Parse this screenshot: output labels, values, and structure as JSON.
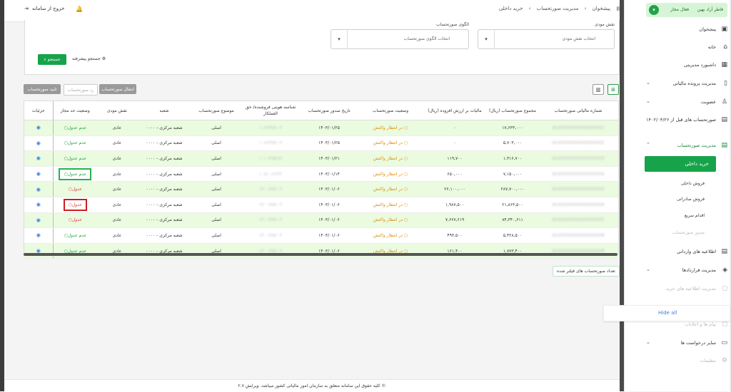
{
  "breadcrumb": [
    "پیشخوان",
    "مدیریت صورتحساب",
    "خرید داخلی"
  ],
  "logout_label": "خروج از سامانه",
  "filters": {
    "role_label": "نقش مودی",
    "role_placeholder": "انتخاب نقش مودی",
    "pattern_label": "الگوی صورتحساب",
    "pattern_placeholder": "انتخاب الگوی صورتحساب",
    "search_button": "جستجو",
    "advanced_search": "جستجو پیشرفته"
  },
  "actions": {
    "transfer": "انتقال صورتحساب",
    "reject": "رد صورتحساب",
    "approve": "تایید صورتحساب"
  },
  "table": {
    "headers": [
      "شماره مالیاتی صورتحساب",
      "مجموع صورتحساب (ریال)",
      "مالیات بر ارزش افزوده (ریال)",
      "وضعیت صورتحساب",
      "تاریخ صدور صورتحساب",
      "شناسه هویتی فروشنده/ حق العملکار",
      "موضوع صورتحساب",
      "شعبه",
      "نقش مودی",
      "وضعیت حد مجاز",
      "جزئیات"
    ],
    "rows": [
      {
        "tax_id": "A1XXXXXXXXXXXXXX01",
        "total": "۱۷,۶۳۳,۰۰۰",
        "vat": "۰",
        "status": "در انتظار واکنش",
        "date": "۱۴۰۳/۰۱/۲۵",
        "seller": "۱۰۸۶۳۳۵۱۰۴",
        "subject": "اصلی",
        "branch": "شعبه مرکزی - ۰۰۰۰",
        "role": "عادی",
        "limit": "عدم عدول",
        "limit_type": "ok"
      },
      {
        "tax_id": "A1XXXXXXXXXXXXXX02",
        "total": "۵,۷۰۳,۰۰۰",
        "vat": "۰",
        "status": "در انتظار واکنش",
        "date": "۱۴۰۳/۰۱/۲۵",
        "seller": "۱۰۸۶۳۳۵۱۰۴",
        "subject": "اصلی",
        "branch": "شعبه مرکزی - ۰۰۰۰",
        "role": "عادی",
        "limit": "عدم عدول",
        "limit_type": "ok"
      },
      {
        "tax_id": "A1XXXXXXXXXXXXXX03",
        "total": "۱,۳۱۶,۷۰۰",
        "vat": "۱۱۹,۷۰۰",
        "status": "در انتظار واکنش",
        "date": "۱۴۰۳/۰۱/۲۱",
        "seller": "۱۰۱۰۳۶۵۲۸۷",
        "subject": "اصلی",
        "branch": "شعبه مرکزی - ۰۰۰۰",
        "role": "عادی",
        "limit": "عدم عدول",
        "limit_type": "ok"
      },
      {
        "tax_id": "A1XXXXXXXXXXXXXX04",
        "total": "۷,۱۵۰,۰۰۰",
        "vat": "۶۵۰,۰۰۰",
        "status": "در انتظار واکنش",
        "date": "۱۴۰۳/۰۱/۱۴",
        "seller": "۱۰۸۶۰۱۲۶۳۶",
        "subject": "اصلی",
        "branch": "شعبه مرکزی - ۰۰۰۰",
        "role": "عادی",
        "limit": "عدم عدول",
        "limit_type": "ok"
      },
      {
        "tax_id": "A1XXXXXXXXXXXXXX05",
        "total": "۲۸۷,۷۰۰,۰۰۰",
        "vat": "۲۶,۱۰۰,۰۰۰",
        "status": "در انتظار واکنش",
        "date": "۱۴۰۳/۰۱/۰۶",
        "seller": "۱۴۰۰۶۳۵۱۰۴",
        "subject": "اصلی",
        "branch": "شعبه مرکزی - ۰۰۰۰",
        "role": "عادی",
        "limit": "عدول",
        "limit_type": "bad"
      },
      {
        "tax_id": "A1XXXXXXXXXXXXXX06",
        "total": "۲۱,۸۶۳,۵۰۰",
        "vat": "۱,۹۸۷,۵۰۰",
        "status": "در انتظار واکنش",
        "date": "۱۴۰۳/۰۱/۰۶",
        "seller": "۱۴۰۰۶۳۵۱۰۴",
        "subject": "اصلی",
        "branch": "شعبه مرکزی - ۰۰۰۰",
        "role": "عادی",
        "limit": "عدول",
        "limit_type": "bad"
      },
      {
        "tax_id": "A1XXXXXXXXXXXXXX07",
        "total": "۸۴,۳۴۰,۶۱۱",
        "vat": "۷,۶۶۷,۶۱۹",
        "status": "در انتظار واکنش",
        "date": "۱۴۰۳/۰۱/۰۶",
        "seller": "۱۴۰۰۶۳۵۱۰۴",
        "subject": "اصلی",
        "branch": "شعبه مرکزی - ۰۰۰۰",
        "role": "عادی",
        "limit": "عدول",
        "limit_type": "bad"
      },
      {
        "tax_id": "A1XXXXXXXXXXXXXX08",
        "total": "۵,۴۲۸,۵۰۰",
        "vat": "۴۹۳,۵۰۰",
        "status": "در انتظار واکنش",
        "date": "۱۴۰۳/۰۱/۰۶",
        "seller": "۱۴۰۰۶۳۵۱۰۴",
        "subject": "اصلی",
        "branch": "شعبه مرکزی - ۰۰۰۰",
        "role": "عادی",
        "limit": "عدم عدول",
        "limit_type": "ok"
      },
      {
        "tax_id": "A1XXXXXXXXXXXXXX09",
        "total": "۱,۷۷۳,۴۰۰",
        "vat": "۱۶۱,۴۰۰",
        "status": "در انتظار واکنش",
        "date": "۱۴۰۳/۰۱/۰۶",
        "seller": "۱۴۰۰۶۳۵۱۰۴",
        "subject": "اصلی",
        "branch": "شعبه مرکزی - ۰۰۰۰",
        "role": "عادی",
        "limit": "عدم عدول",
        "limit_type": "ok"
      }
    ]
  },
  "filtered_count_button": "تعداد صورتحساب های فیلتر شده",
  "footer": "© کلیه حقوق این سامانه متعلق به سازمان امور مالیاتی کشور میباشد. ویرایش ۲.۷",
  "sidebar": {
    "user_name": "فاطر آراد بهین",
    "user_state": "فعال مجاز",
    "items": [
      {
        "label": "پیشخوان",
        "icon": "dashboard-icon"
      },
      {
        "label": "خانه",
        "icon": "home-icon"
      },
      {
        "label": "داشبورد مدیریتی",
        "icon": "grid-icon"
      },
      {
        "label": "مدیریت پرونده مالیاتی",
        "icon": "file-icon"
      },
      {
        "label": "عضویت",
        "icon": "user-icon"
      },
      {
        "label": "صورتحساب های قبل از ۱۴۰۲/۰۴/۲۶",
        "icon": "receipt-icon"
      },
      {
        "label": "مدیریت صورتحساب",
        "icon": "invoice-icon"
      }
    ],
    "subitems": [
      "خرید داخلی",
      "فروش داخلی",
      "فروش صادراتی",
      "اقدام سریع",
      "صدور صورتحساب"
    ],
    "items2": [
      {
        "label": "اطلاعیه های وارداتی",
        "icon": "import-icon"
      },
      {
        "label": "مدیریت قراردادها",
        "icon": "contract-icon"
      },
      {
        "label": "مدیریت اطلاعیه های خرید",
        "icon": "bag-icon"
      },
      {
        "label": "پیام ها و اعلانات",
        "icon": "message-icon"
      },
      {
        "label": "سایر درخواست ها",
        "icon": "chat-icon"
      },
      {
        "label": "تنظیمات",
        "icon": "gear-icon"
      }
    ]
  },
  "hide_all": "Hide all"
}
